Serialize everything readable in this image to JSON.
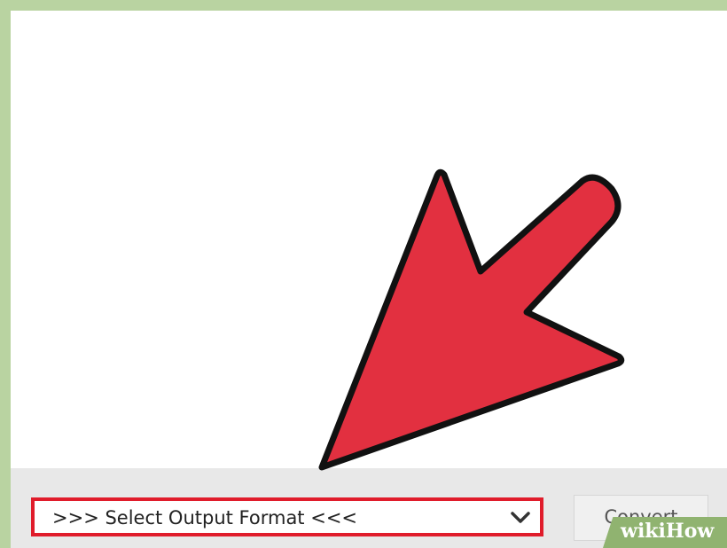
{
  "format_select": {
    "selected_text": ">>> Select Output Format <<<",
    "highlight_color": "#e01c2b",
    "icon": "chevron-down-icon"
  },
  "convert_button": {
    "label": "Convert"
  },
  "pointer_arrow": {
    "fill_color": "#e23040",
    "icon": "arrow-pointer-icon"
  },
  "watermark": {
    "text_wiki": "wiki",
    "text_how": "How"
  },
  "colors": {
    "frame": "#b9d3a1",
    "bar": "#e8e8e8"
  }
}
